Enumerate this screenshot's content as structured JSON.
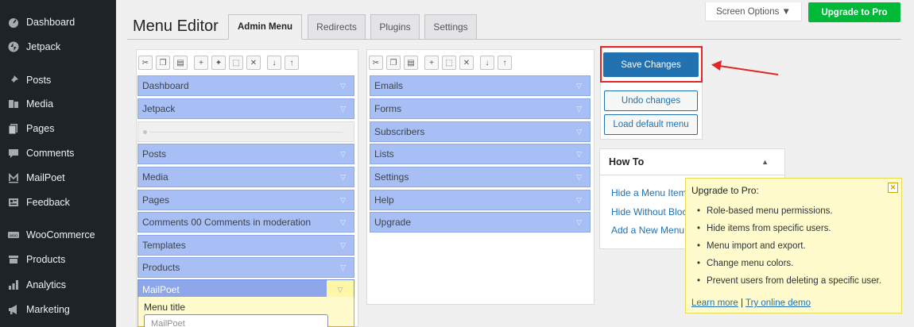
{
  "sidebar": {
    "items": [
      {
        "label": "Dashboard",
        "icon": "dashboard-icon"
      },
      {
        "label": "Jetpack",
        "icon": "jetpack-icon"
      },
      {
        "label": "Posts",
        "icon": "pin-icon"
      },
      {
        "label": "Media",
        "icon": "media-icon"
      },
      {
        "label": "Pages",
        "icon": "pages-icon"
      },
      {
        "label": "Comments",
        "icon": "comment-icon"
      },
      {
        "label": "MailPoet",
        "icon": "mailpoet-icon"
      },
      {
        "label": "Feedback",
        "icon": "feedback-icon"
      },
      {
        "label": "WooCommerce",
        "icon": "woo-icon"
      },
      {
        "label": "Products",
        "icon": "products-icon"
      },
      {
        "label": "Analytics",
        "icon": "analytics-icon"
      },
      {
        "label": "Marketing",
        "icon": "megaphone-icon"
      }
    ]
  },
  "header": {
    "screen_options": "Screen Options ▼",
    "upgrade_button": "Upgrade to Pro"
  },
  "page_title": "Menu Editor",
  "tabs": [
    {
      "label": "Admin Menu",
      "active": true
    },
    {
      "label": "Redirects",
      "active": false
    },
    {
      "label": "Plugins",
      "active": false
    },
    {
      "label": "Settings",
      "active": false
    }
  ],
  "left_menu": {
    "items": [
      {
        "label": "Dashboard",
        "type": "item"
      },
      {
        "label": "Jetpack",
        "type": "item"
      },
      {
        "label": "",
        "type": "separator"
      },
      {
        "label": "Posts",
        "type": "item"
      },
      {
        "label": "Media",
        "type": "item"
      },
      {
        "label": "Pages",
        "type": "item"
      },
      {
        "label": "Comments 00 Comments in moderation",
        "type": "item"
      },
      {
        "label": "Templates",
        "type": "item"
      },
      {
        "label": "Products",
        "type": "item"
      },
      {
        "label": "MailPoet",
        "type": "selected"
      }
    ]
  },
  "right_menu": {
    "items": [
      {
        "label": "Emails"
      },
      {
        "label": "Forms"
      },
      {
        "label": "Subscribers"
      },
      {
        "label": "Lists"
      },
      {
        "label": "Settings"
      },
      {
        "label": "Help"
      },
      {
        "label": "Upgrade"
      }
    ]
  },
  "actions": {
    "save": "Save Changes",
    "undo": "Undo changes",
    "load_default": "Load default menu"
  },
  "howto": {
    "title": "How To",
    "links": [
      "Hide a Menu Item",
      "Hide Without Bloc",
      "Add a New Menu"
    ]
  },
  "tooltip": {
    "title": "Upgrade to Pro:",
    "items": [
      "Role-based menu permissions.",
      "Hide items from specific users.",
      "Menu import and export.",
      "Change menu colors.",
      "Prevent users from deleting a specific user."
    ],
    "learn_more": "Learn more",
    "divider": " | ",
    "demo": "Try online demo"
  },
  "editor": {
    "field_label": "Menu title",
    "field_value": "MailPoet"
  },
  "colors": {
    "sidebar_bg": "#1d2327",
    "menu_item_bg": "#a8bff5",
    "primary_button": "#2271b1",
    "upgrade_button": "#00ba37",
    "highlight_red": "#e32626",
    "tooltip_bg": "#fffbcc"
  }
}
